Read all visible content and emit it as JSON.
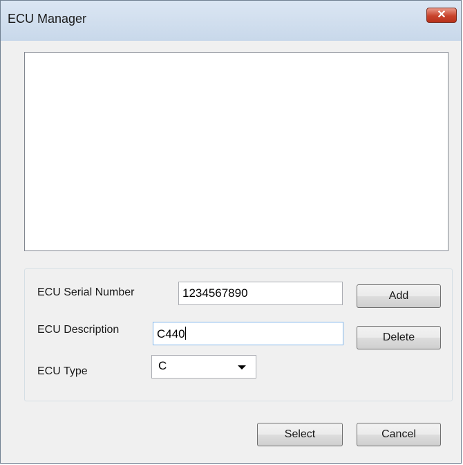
{
  "window": {
    "title": "ECU Manager",
    "close_glyph": "✕"
  },
  "list": {
    "items": []
  },
  "form": {
    "serial_label": "ECU Serial Number",
    "serial_value": "1234567890",
    "description_label": "ECU Description",
    "description_value": "C440",
    "type_label": "ECU Type",
    "type_value": "C"
  },
  "buttons": {
    "add": "Add",
    "delete": "Delete",
    "select": "Select",
    "cancel": "Cancel"
  }
}
